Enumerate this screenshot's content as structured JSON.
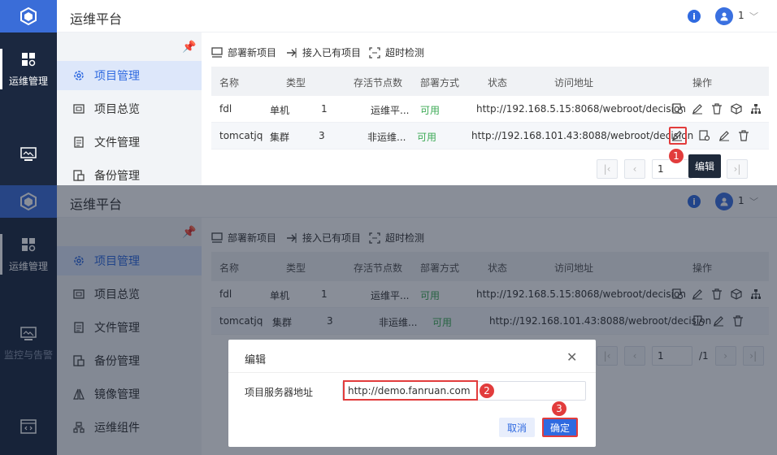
{
  "app": {
    "title": "运维平台",
    "user": "1",
    "info_icon": "i"
  },
  "nav": [
    {
      "label": "运维管理",
      "icon": "apps-icon"
    },
    {
      "label": "监控与告警",
      "icon": "monitor-icon"
    },
    {
      "label": "",
      "icon": "code-icon"
    }
  ],
  "submenu": [
    "项目管理",
    "项目总览",
    "文件管理",
    "备份管理",
    "镜像管理",
    "运维组件"
  ],
  "toolbar": {
    "deploy": "部署新项目",
    "import": "接入已有项目",
    "timeout": "超时检测"
  },
  "table": {
    "headers": [
      "名称",
      "类型",
      "存活节点数",
      "部署方式",
      "状态",
      "访问地址",
      "操作"
    ],
    "rows": [
      {
        "name": "fdl",
        "type": "单机",
        "nodes": "1",
        "deploy": "运维平...",
        "status": "可用",
        "url": "http://192.168.5.15:8068/webroot/decision"
      },
      {
        "name": "tomcatjq",
        "type": "集群",
        "nodes": "3",
        "deploy": "非运维...",
        "status": "可用",
        "url": "http://192.168.101.43:8088/webroot/decision"
      }
    ]
  },
  "pager": {
    "page": "1",
    "total": "/1"
  },
  "tooltip": "编辑",
  "steps": [
    "1",
    "2",
    "3"
  ],
  "dialog": {
    "title": "编辑",
    "label": "项目服务器地址",
    "value": "http://demo.fanruan.com",
    "cancel": "取消",
    "ok": "确定"
  },
  "colors": {
    "accent": "#2f6ae0",
    "sidebar": "#1b2840",
    "ok": "#3caa55",
    "highlight": "#e23c3c"
  }
}
